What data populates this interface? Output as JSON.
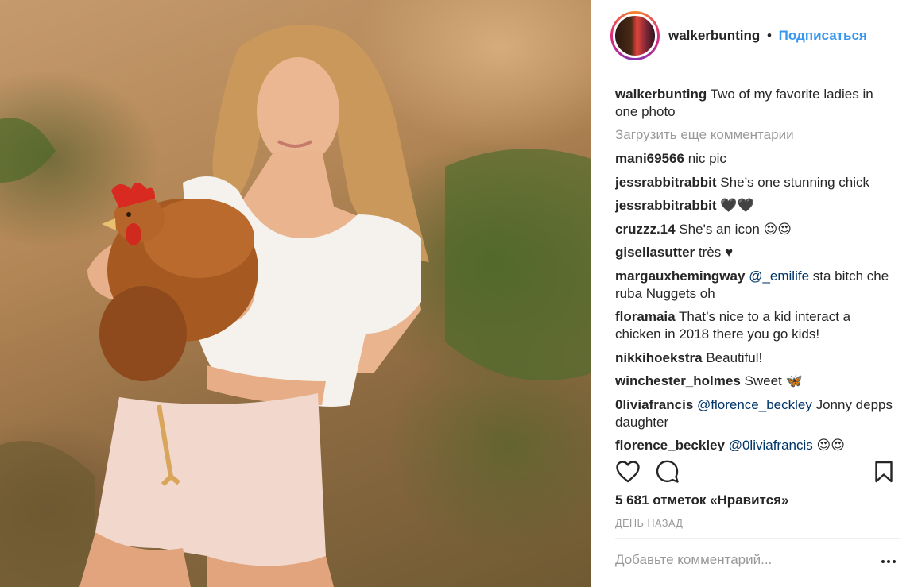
{
  "header": {
    "username": "walkerbunting",
    "separator": "•",
    "follow_label": "Подписаться"
  },
  "caption": {
    "username": "walkerbunting",
    "text": "Two of my favorite ladies in one photo"
  },
  "load_more_label": "Загрузить еще комментарии",
  "comments": [
    {
      "user": "mani69566",
      "text": "nic pic"
    },
    {
      "user": "jessrabbitrabbit",
      "text": "She’s one stunning chick"
    },
    {
      "user": "jessrabbitrabbit",
      "text": "🖤🖤"
    },
    {
      "user": "cruzzz.14",
      "text": "She's an icon 😍😍"
    },
    {
      "user": "gisellasutter",
      "text": "très ♥"
    },
    {
      "user": "margauxhemingway",
      "mention": "@_emilife",
      "text": "sta bitch che ruba Nuggets oh"
    },
    {
      "user": "floramaia",
      "text": "That’s nice to a kid interact a chicken in 2018 there you go kids!"
    },
    {
      "user": "nikkihoekstra",
      "text": "Beautiful!"
    },
    {
      "user": "winchester_holmes",
      "text": "Sweet 🦋"
    },
    {
      "user": "0liviafrancis",
      "mention": "@florence_beckley",
      "text": "Jonny depps daughter"
    },
    {
      "user": "florence_beckley",
      "mention": "@0liviafrancis",
      "text": "😍😍"
    }
  ],
  "actions": {
    "like_icon": "heart-icon",
    "comment_icon": "comment-icon",
    "save_icon": "bookmark-icon",
    "more_icon": "more-options-icon"
  },
  "likes_text": "5 681 отметок «Нравится»",
  "date_text": "ДЕНЬ НАЗАД",
  "add_comment_placeholder": "Добавьте комментарий...",
  "colors": {
    "link_blue": "#3897f0",
    "mention_blue": "#003569",
    "muted_gray": "#999999",
    "text_dark": "#262626"
  }
}
